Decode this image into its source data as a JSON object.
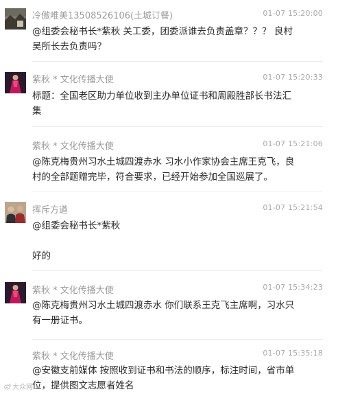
{
  "messages": [
    {
      "name": "冷傲唯美13508526106(土城订餐)",
      "time": "01-07 15:20:00",
      "lines": [
        "@组委会秘书长*紫秋 关工委，团委派谁去负责盖章？？？ 良村",
        "吴所长去负责吗？"
      ]
    },
    {
      "name": "紫秋 * 文化传播大使",
      "time": "01-07 15:20:33",
      "lines": [
        "标题：全国老区助力单位收到主办单位证书和周殿胜部长书法汇",
        "集"
      ]
    },
    {
      "name": "紫秋 * 文化传播大使",
      "time": "01-07 15:21:06",
      "lines": [
        "@陈克梅贵州习水土城四渡赤水 习水小作家协会主席王克飞，良",
        "村的全部题赠完毕，符合要求，已经开始参加全国巡展了。"
      ]
    },
    {
      "name": "挥斥方遒",
      "time": "01-07 15:21:54",
      "lines": [
        "@组委会秘书长*紫秋",
        "",
        "好的"
      ]
    },
    {
      "name": "紫秋 * 文化传播大使",
      "time": "01-07 15:34:23",
      "lines": [
        "@陈克梅贵州习水土城四渡赤水 你们联系王克飞主席啊，习水只",
        "有一册证书。"
      ]
    },
    {
      "name": "紫秋 * 文化传播大使",
      "time": "01-07 15:35:18",
      "lines": [
        "@安徽支前媒体 按照收到证书和书法的顺序，标注时间，省市单",
        "位，提供图文志愿者姓名"
      ]
    }
  ],
  "watermark": "大众网",
  "icons": {
    "avatar_1": "avatar-landscape-photo-icon",
    "avatar_2": "avatar-woman-red-dress-icon",
    "avatar_4": "avatar-people-photo-icon",
    "watermark": "weibo-logo-icon"
  },
  "colors": {
    "name_text": "#9a9a9a",
    "time_text": "#a8a8a8",
    "body_text": "#2a2a2a",
    "divider": "#ececec"
  }
}
